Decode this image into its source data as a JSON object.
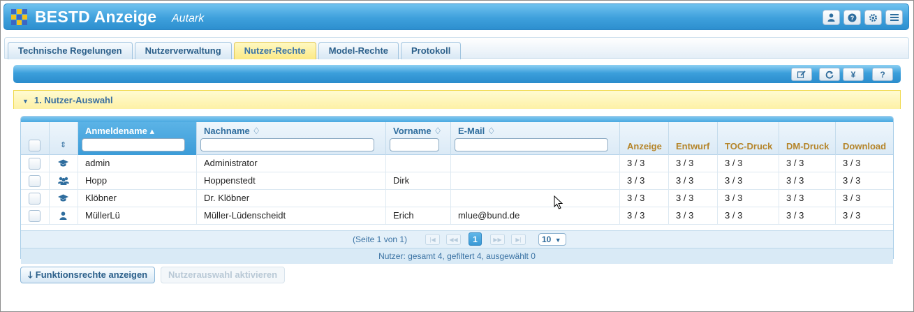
{
  "app": {
    "title": "BESTD Anzeige",
    "subtitle": "Autark"
  },
  "header_buttons": [
    {
      "icon": "user-icon",
      "glyph": "♙"
    },
    {
      "icon": "help-icon",
      "glyph": "?"
    },
    {
      "icon": "gear-icon",
      "glyph": "⚙"
    },
    {
      "icon": "menu-icon",
      "glyph": "≡"
    }
  ],
  "tabs": [
    {
      "label": "Technische Regelungen",
      "active": false
    },
    {
      "label": "Nutzerverwaltung",
      "active": false
    },
    {
      "label": "Nutzer-Rechte",
      "active": true
    },
    {
      "label": "Model-Rechte",
      "active": false
    },
    {
      "label": "Protokoll",
      "active": false
    }
  ],
  "toolbar": {
    "yen_label": "¥",
    "help_label": "?"
  },
  "section": {
    "title": "1. Nutzer-Auswahl"
  },
  "grid": {
    "columns": {
      "login": "Anmeldename ▴",
      "lastname": "Nachname ♢",
      "firstname": "Vorname ♢",
      "email": "E-Mail ♢",
      "anzeige": "Anzeige",
      "entwurf": "Entwurf",
      "toc": "TOC-Druck",
      "dm": "DM-Druck",
      "download": "Download"
    },
    "rows": [
      {
        "type_icon": "graduation-cap-icon",
        "login": "admin",
        "lastname": "Administrator",
        "firstname": "",
        "email": "",
        "anzeige": "3 / 3",
        "entwurf": "3 / 3",
        "toc": "3 / 3",
        "dm": "3 / 3",
        "download": "3 / 3"
      },
      {
        "type_icon": "users-icon",
        "login": "Hopp",
        "lastname": "Hoppenstedt",
        "firstname": "Dirk",
        "email": "",
        "anzeige": "3 / 3",
        "entwurf": "3 / 3",
        "toc": "3 / 3",
        "dm": "3 / 3",
        "download": "3 / 3"
      },
      {
        "type_icon": "graduation-cap-icon",
        "login": "Klöbner",
        "lastname": "Dr. Klöbner",
        "firstname": "",
        "email": "",
        "anzeige": "3 / 3",
        "entwurf": "3 / 3",
        "toc": "3 / 3",
        "dm": "3 / 3",
        "download": "3 / 3"
      },
      {
        "type_icon": "user-icon",
        "login": "MüllerLü",
        "lastname": "Müller-Lüdenscheidt",
        "firstname": "Erich",
        "email": "mlue@bund.de",
        "anzeige": "3 / 3",
        "entwurf": "3 / 3",
        "toc": "3 / 3",
        "dm": "3 / 3",
        "download": "3 / 3"
      }
    ],
    "pager": {
      "page_info": "(Seite 1 von 1)",
      "current_page": "1",
      "page_size": "10"
    },
    "status": "Nutzer: gesamt 4, gefiltert 4, ausgewählt 0"
  },
  "actions": {
    "show_rights": "Funktionsrechte anzeigen",
    "activate_selection": "Nutzerauswahl aktivieren"
  },
  "colors": {
    "accent": "#3ea0dc",
    "section_bg": "#fdf1a6",
    "header_perm_text": "#b5852a"
  }
}
